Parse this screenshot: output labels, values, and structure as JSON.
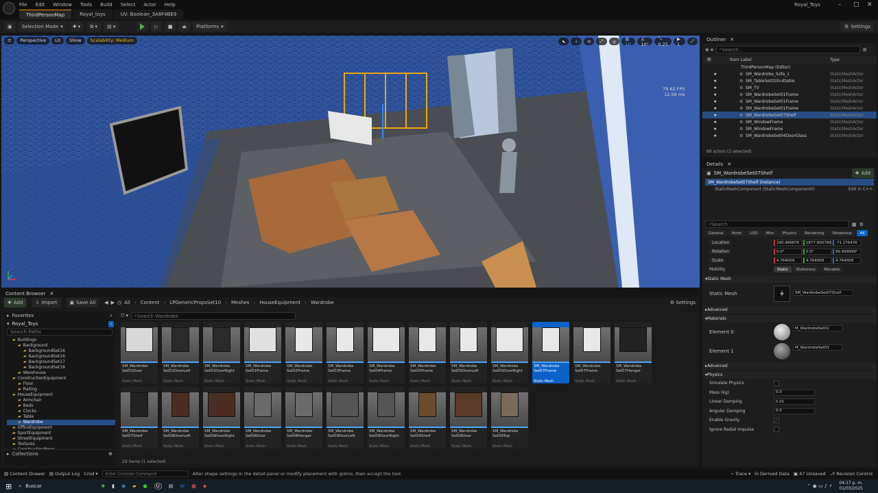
{
  "menu": [
    "File",
    "Edit",
    "Window",
    "Tools",
    "Build",
    "Select",
    "Actor",
    "Help"
  ],
  "tabs": [
    "ThirdPersonMap",
    "Royal_toys",
    "UV: Boolean_3A6F4BE9"
  ],
  "project": "Royal_Toys",
  "toolbar": {
    "mode": "Selection Mode",
    "platforms": "Platforms",
    "settings": "Settings"
  },
  "viewport": {
    "perspective": "Perspective",
    "lit": "Lit",
    "show": "Show",
    "scalability": "Scalability: Medium",
    "stats": [
      "79.62 FPS",
      "12.56 ms"
    ]
  },
  "outliner": {
    "title": "Outliner",
    "search": "Search...",
    "col_label": "Item Label",
    "col_type": "Type",
    "root": "ThirdPersonMap (Editor)",
    "rows": [
      {
        "label": "SM_Wardrobe_Sofa_1",
        "type": "StaticMeshActor"
      },
      {
        "label": "SM_TableSet01Endtable",
        "type": "StaticMeshActor"
      },
      {
        "label": "SM_TV",
        "type": "StaticMeshActor"
      },
      {
        "label": "SM_WardrobeSet01Frame",
        "type": "StaticMeshActor"
      },
      {
        "label": "SM_WardrobeSet01Frame",
        "type": "StaticMeshActor"
      },
      {
        "label": "SM_WardrobeSet01Frame",
        "type": "StaticMeshActor"
      },
      {
        "label": "SM_WardrobeSet07Shelf",
        "type": "StaticMeshActor"
      },
      {
        "label": "SM_WindowFrame",
        "type": "StaticMeshActor"
      },
      {
        "label": "SM_WindowFrame",
        "type": "StaticMeshActor"
      },
      {
        "label": "SM_WardrobeSet04DoorGlass",
        "type": "StaticMeshActor"
      }
    ],
    "count": "88 actors (1 selected)"
  },
  "details": {
    "title": "Details",
    "actor": "SM_WardrobeSet07Shelf",
    "add": "Add",
    "instance": "SM_WardrobeSet07Shelf (Instance)",
    "component": "StaticMeshComponent (StaticMeshComponent0)",
    "edit_cpp": "Edit in C++",
    "search": "Search",
    "filters": [
      "General",
      "Actor",
      "LOD",
      "Misc",
      "Physics",
      "Rendering",
      "Streaming",
      "All"
    ],
    "transform": [
      {
        "label": "Location",
        "x": "290.489876",
        "y": "2877.800789",
        "z": "-71.276476"
      },
      {
        "label": "Rotation",
        "x": "0.0°",
        "y": "0.0°",
        "z": "89.999999°"
      },
      {
        "label": "Scale",
        "x": "4.764009",
        "y": "4.764009",
        "z": "4.764009"
      }
    ],
    "mobility": {
      "label": "Mobility",
      "options": [
        "Static",
        "Stationary",
        "Movable"
      ]
    },
    "sections": {
      "static_mesh": "Static Mesh",
      "advanced": "Advanced",
      "materials": "Materials",
      "physics": "Physics",
      "constraints": "Constraints"
    },
    "static_mesh_label": "Static Mesh",
    "static_mesh_value": "SM_WardrobeSet07Shelf",
    "materials": [
      {
        "label": "Element 0",
        "value": "M_WardrobeSet01"
      },
      {
        "label": "Element 1",
        "value": "M_WardrobeSet01"
      }
    ],
    "physics": [
      {
        "label": "Simulate Physics",
        "value": ""
      },
      {
        "label": "Mass (kg)",
        "value": "0.0"
      },
      {
        "label": "Linear Damping",
        "value": "0.01"
      },
      {
        "label": "Angular Damping",
        "value": "0.0"
      },
      {
        "label": "Enable Gravity",
        "value": ""
      },
      {
        "label": "Ignore Radial Impulse",
        "value": ""
      }
    ]
  },
  "content": {
    "title": "Content Browser",
    "add": "Add",
    "import": "Import",
    "save_all": "Save All",
    "path": [
      "All",
      "Content",
      "LPGenericPropsSet10",
      "Meshes",
      "HouseEquipment",
      "Wardrobe"
    ],
    "settings": "Settings",
    "favorites": "Favorites",
    "root": "Royal_Toys",
    "search_paths": "Search Paths",
    "search_assets": "Search Wardrobe",
    "collections": "Collections",
    "items": "29 items (1 selected)",
    "tree": [
      "Buildings",
      "Background",
      "BackgroundSet16",
      "BackgroundSet16",
      "BackgroundSet17",
      "BackgroundSet18",
      "Warehouse",
      "ConstructionEquipment",
      "Floor",
      "Railing",
      "HouseEquipment",
      "Armchair",
      "Beds",
      "Clocks",
      "Table",
      "Wardrobe",
      "OfficeEquipment",
      "SportEquipment",
      "StreetEquipment",
      "Textures",
      "ConstructionProps"
    ],
    "assets": [
      [
        "SM_Wardrobe\nSet01Door",
        "Static Mesh"
      ],
      [
        "SM_Wardrobe\nSet01DoorLeft",
        "Static Mesh"
      ],
      [
        "SM_Wardrobe\nSet01DoorRight",
        "Static Mesh"
      ],
      [
        "SM_Wardrobe\nSet01Frame",
        "Static Mesh"
      ],
      [
        "SM_Wardrobe\nSet02Frame",
        "Static Mesh"
      ],
      [
        "SM_Wardrobe\nSet03Frame",
        "Static Mesh"
      ],
      [
        "SM_Wardrobe\nSet04Frame",
        "Static Mesh"
      ],
      [
        "SM_Wardrobe\nSet05Frame",
        "Static Mesh"
      ],
      [
        "SM_Wardrobe\nSet05DoorLeft",
        "Static Mesh"
      ],
      [
        "SM_Wardrobe\nSet05DoorRight",
        "Static Mesh"
      ],
      [
        "SM_Wardrobe\nSet07Frame",
        "Static Mesh"
      ],
      [
        "SM_Wardrobe\nSet07Frame",
        "Static Mesh"
      ],
      [
        "SM_Wardrobe\nSet07Hanger",
        "Static Mesh"
      ],
      [
        "SM_Wardrobe\nSet07Shelf",
        "Static Mesh"
      ],
      [
        "SM_Wardrobe\nSet08DoorLeft",
        "Static Mesh"
      ],
      [
        "SM_Wardrobe\nSet08DoorRight",
        "Static Mesh"
      ],
      [
        "SM_Wardrobe\nSet08Door",
        "Static Mesh"
      ],
      [
        "SM_Wardrobe\nSet08Hanger",
        "Static Mesh"
      ],
      [
        "SM_Wardrobe\nSet09DoorLeft",
        "Static Mesh"
      ],
      [
        "SM_Wardrobe\nSet09DoorRight",
        "Static Mesh"
      ],
      [
        "SM_Wardrobe\nSet09Shelf",
        "Static Mesh"
      ],
      [
        "SM_Wardrobe\nSet09Door",
        "Static Mesh"
      ],
      [
        "SM_Wardrobe\nSet09Top",
        "Static Mesh"
      ]
    ]
  },
  "statusbar": {
    "content_drawer": "Content Drawer",
    "output_log": "Output Log",
    "cmd": "Cmd",
    "console": "Enter Console Command",
    "hint": "Alter shape settings in the detail panel or modify placement with gizmo, then accept the tool.",
    "trace": "Trace",
    "derived": "Derived Data",
    "unsaved": "47 Unsaved",
    "revision": "Revision Control"
  },
  "taskbar": {
    "search": "Buscar",
    "time": "04:17 p. m.",
    "date": "01/03/2025"
  },
  "colors": {
    "accent": "#0a62c8",
    "select": "#f2c200"
  }
}
